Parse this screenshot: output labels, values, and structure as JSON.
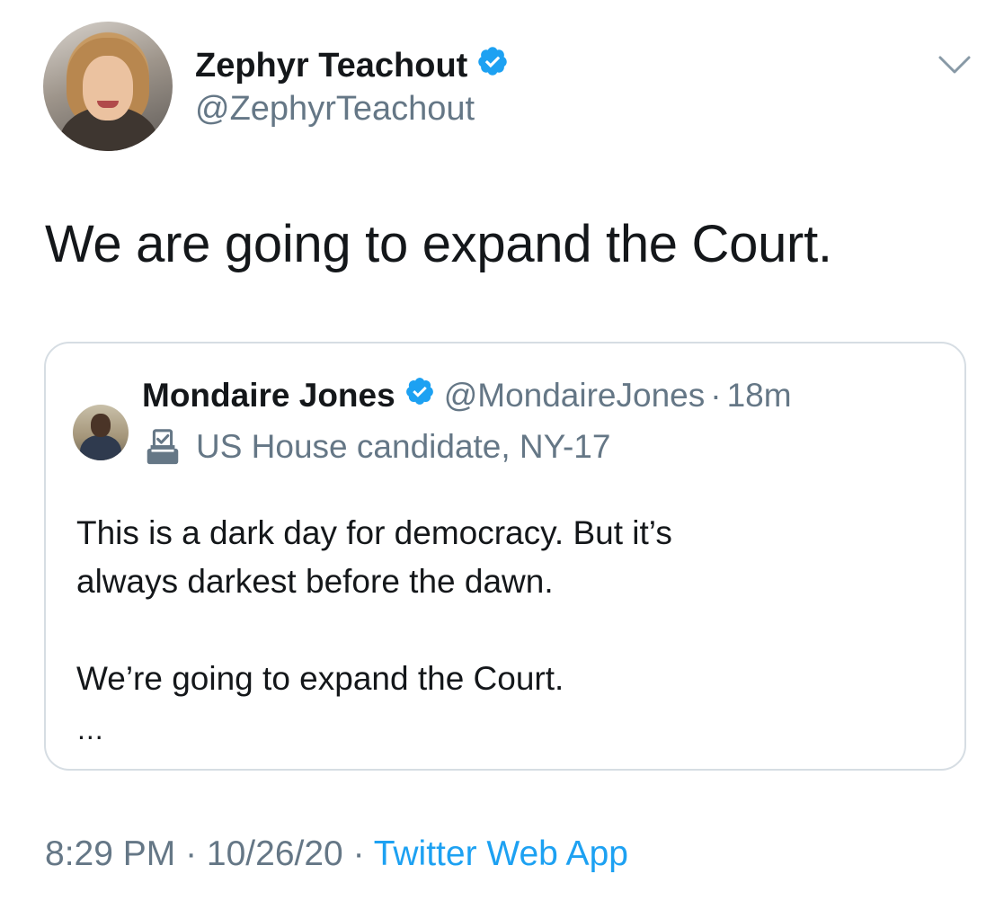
{
  "author": {
    "name": "Zephyr Teachout",
    "handle": "@ZephyrTeachout",
    "verified": true,
    "avatar_icon": "profile-photo"
  },
  "tweet": {
    "text": "We are going to expand the Court."
  },
  "quoted": {
    "name": "Mondaire Jones",
    "handle": "@MondaireJones",
    "separator": "·",
    "time": "18m",
    "verified": true,
    "label_icon": "ballot-box-icon",
    "label": "US House candidate, NY-17",
    "text_lines": [
      "This is a dark day for democracy. But it’s",
      "always darkest before the dawn.",
      "",
      "We’re going to expand the Court."
    ],
    "truncation": "..."
  },
  "meta": {
    "time": "8:29 PM",
    "sep1": " · ",
    "date": "10/26/20",
    "sep2": " · ",
    "source": "Twitter Web App"
  },
  "colors": {
    "text": "#14171a",
    "secondary": "#657786",
    "accent": "#1da1f2",
    "border": "#d6dde3"
  }
}
